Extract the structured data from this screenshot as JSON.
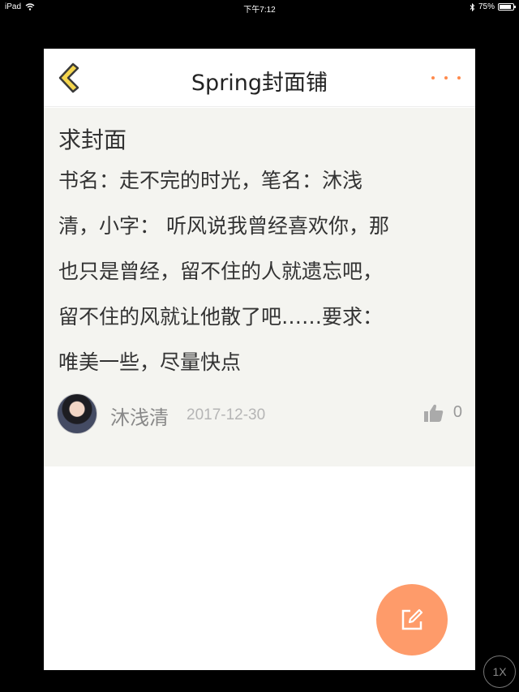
{
  "status_bar": {
    "device": "iPad",
    "time": "下午7:12",
    "battery": "75%"
  },
  "navbar": {
    "title": "Spring封面铺"
  },
  "post": {
    "title": "求封面",
    "body": "书名：走不完的时光，笔名：沐浅\n清，小字： 听风说我曾经喜欢你，那\n也只是曾经，留不住的人就遗忘吧，\n留不住的风就让他散了吧……要求：\n唯美一些，尽量快点",
    "author": "沐浅清",
    "date": "2017-12-30",
    "likes": "0"
  },
  "overlay": {
    "zoom_label": "1X"
  },
  "colors": {
    "accent": "#ff8a4c",
    "fab": "#fe9b6a",
    "card_bg": "#f4f4f0",
    "back_icon_fill": "#f5d64e"
  },
  "icons": [
    "back-chevron-icon",
    "more-dots-icon",
    "thumbs-up-icon",
    "edit-icon",
    "wifi-icon",
    "bluetooth-icon",
    "battery-icon"
  ]
}
